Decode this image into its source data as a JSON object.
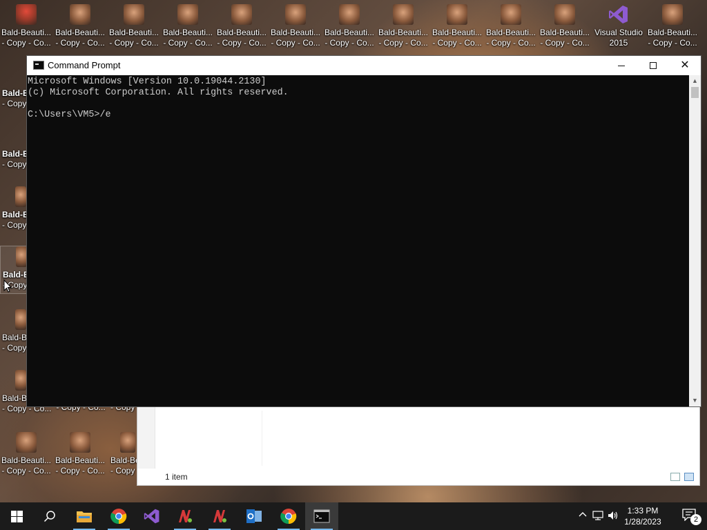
{
  "desktop": {
    "top_row": [
      {
        "line1": "Bald-Beauti...",
        "line2": "- Copy - Co..."
      },
      {
        "line1": "Bald-Beauti...",
        "line2": "- Copy - Co..."
      },
      {
        "line1": "Bald-Beauti...",
        "line2": "- Copy - Co..."
      },
      {
        "line1": "Bald-Beauti...",
        "line2": "- Copy - Co..."
      },
      {
        "line1": "Bald-Beauti...",
        "line2": "- Copy - Co..."
      },
      {
        "line1": "Bald-Beauti...",
        "line2": "- Copy - Co..."
      },
      {
        "line1": "Bald-Beauti...",
        "line2": "- Copy - Co..."
      },
      {
        "line1": "Bald-Beauti...",
        "line2": "- Copy - Co..."
      },
      {
        "line1": "Bald-Beauti...",
        "line2": "- Copy - Co..."
      },
      {
        "line1": "Bald-Beauti...",
        "line2": "- Copy - Co..."
      },
      {
        "line1": "Visual Studio",
        "line2": "2015"
      },
      {
        "line1": "Bald-Beauti...",
        "line2": "- Copy - Co..."
      }
    ],
    "left_column": [
      {
        "line1": "Bald-B",
        "line2": "- Copy"
      },
      {
        "line1": "Bald-B",
        "line2": "- Copy"
      },
      {
        "line1": "Bald-B",
        "line2": "- Copy"
      },
      {
        "line1": "Bald-B",
        "line2": "- Copy"
      },
      {
        "line1": "Bald-B",
        "line2": "- Copy"
      },
      {
        "line1": "Bald-B",
        "line2": "- Copy - Co..."
      }
    ],
    "row_591": [
      {
        "line2": "- Copy - Co..."
      },
      {
        "line2": "- Copy"
      }
    ],
    "bottom_row": [
      {
        "line1": "Bald-Beauti...",
        "line2": "- Copy - Co..."
      },
      {
        "line1": "Bald-Beauti...",
        "line2": "- Copy - Co..."
      },
      {
        "line1": "Bald-Be",
        "line2": "- Copy"
      }
    ],
    "first_icon_overlap": {
      "line1": "Bald-Beauti...",
      "line2": "- Copy - Co..."
    }
  },
  "cmd_window": {
    "title": "Command Prompt",
    "lines": [
      "Microsoft Windows [Version 10.0.19044.2130]",
      "(c) Microsoft Corporation. All rights reserved.",
      "",
      "C:\\Users\\VM5>/e"
    ]
  },
  "explorer_window": {
    "status_text": "1 item"
  },
  "taskbar": {
    "apps": [
      "start-button",
      "search-icon",
      "file-explorer-icon",
      "chrome-icon",
      "visual-studio-icon",
      "notepad-plus-plus-icon",
      "notepad-plus-plus-icon",
      "outlook-icon",
      "chrome-icon",
      "command-prompt-icon"
    ],
    "time": "1:33 PM",
    "date": "1/28/2023",
    "notification_count": "2"
  }
}
